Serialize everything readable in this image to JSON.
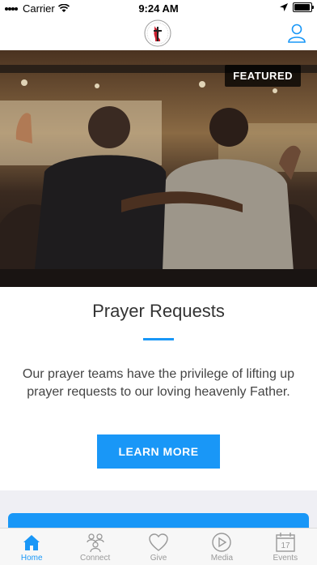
{
  "status_bar": {
    "carrier": "Carrier",
    "time": "9:24 AM"
  },
  "header": {
    "logo_icon": "church-logo-icon",
    "profile_icon": "person-icon"
  },
  "featured_card": {
    "badge": "FEATURED",
    "title": "Prayer Requests",
    "body": "Our prayer teams have the privilege of lifting up prayer requests to our loving heavenly Father.",
    "button_label": "LEARN MORE"
  },
  "tabs": [
    {
      "label": "Home",
      "icon": "home-icon",
      "active": true
    },
    {
      "label": "Connect",
      "icon": "people-icon",
      "active": false
    },
    {
      "label": "Give",
      "icon": "heart-icon",
      "active": false
    },
    {
      "label": "Media",
      "icon": "play-icon",
      "active": false
    },
    {
      "label": "Events",
      "icon": "calendar-icon",
      "active": false
    }
  ],
  "calendar_day": "17",
  "colors": {
    "accent": "#1997f7",
    "inactive": "#999999",
    "background": "#efeff4"
  }
}
